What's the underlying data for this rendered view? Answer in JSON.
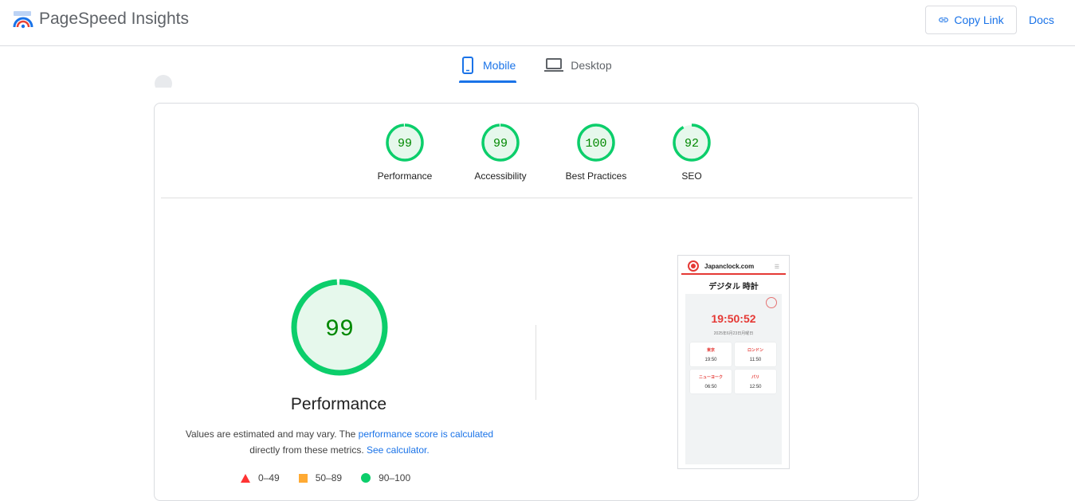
{
  "header": {
    "app_title": "PageSpeed Insights",
    "copy_link_label": "Copy Link",
    "docs_label": "Docs",
    "logo_icon": "pagespeed-logo-icon",
    "link_icon": "link-icon"
  },
  "tabs": [
    {
      "label": "Mobile",
      "icon": "smartphone-icon",
      "active": true
    },
    {
      "label": "Desktop",
      "icon": "laptop-icon",
      "active": false
    }
  ],
  "scores": [
    {
      "label": "Performance",
      "value": "99"
    },
    {
      "label": "Accessibility",
      "value": "99"
    },
    {
      "label": "Best Practices",
      "value": "100"
    },
    {
      "label": "SEO",
      "value": "92"
    }
  ],
  "main_score": {
    "value": "99",
    "label": "Performance",
    "note_text_1": "Values are estimated and may vary. The ",
    "note_link_1": "performance score is calculated",
    "note_text_2": " directly from these metrics. ",
    "note_link_2": "See calculator."
  },
  "legend": [
    {
      "range": "0–49",
      "shape": "triangle",
      "color": "#ff3333"
    },
    {
      "range": "50–89",
      "shape": "square",
      "color": "#ffaa33"
    },
    {
      "range": "90–100",
      "shape": "circle",
      "color": "#0cce6b"
    }
  ],
  "colors": {
    "pass": "#0cce6b",
    "pass_fill": "#e6f8ec",
    "pass_text": "#008800",
    "accent": "#1a73e8"
  },
  "screenshot": {
    "brand": "Japanclock.com",
    "title": "デジタル 時計",
    "time": "19:50:52",
    "date": "2025年6月23日月曜日",
    "cities": [
      {
        "name": "東京",
        "time": "19:50"
      },
      {
        "name": "ロンドン",
        "time": "11:50"
      },
      {
        "name": "ニューヨーク",
        "time": "06:50"
      },
      {
        "name": "パリ",
        "time": "12:50"
      }
    ]
  }
}
